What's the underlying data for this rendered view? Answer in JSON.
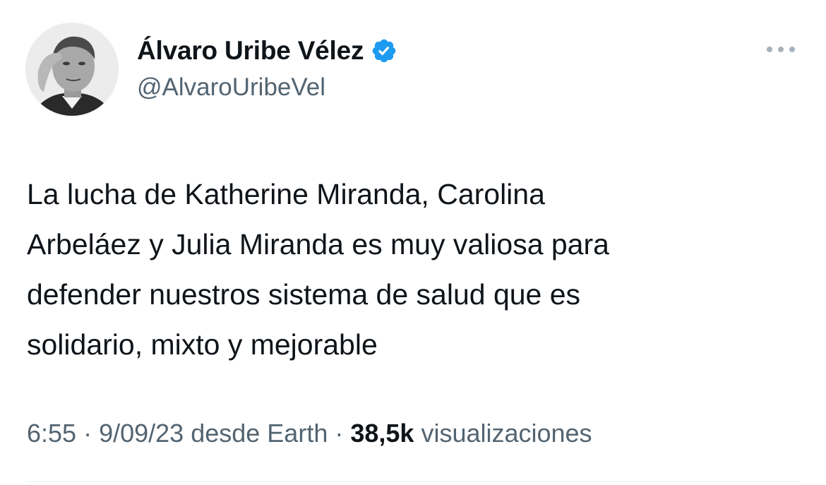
{
  "author": {
    "display_name": "Álvaro Uribe Vélez",
    "handle": "@AlvaroUribeVel",
    "verified_icon": "verified-badge-icon",
    "verified_color": "#1d9bf0"
  },
  "tweet": {
    "text_lines": [
      "La lucha de Katherine Miranda, Carolina",
      "Arbeláez y Julia Miranda es muy valiosa para",
      "defender nuestros sistema de salud que es",
      "solidario, mixto y mejorable"
    ]
  },
  "meta": {
    "time": "6:55",
    "sep1": " · ",
    "date": "9/09/23",
    "source": " desde Earth",
    "sep2": " · ",
    "views": "38,5k",
    "views_label": " visualizaciones"
  },
  "colors": {
    "text_primary": "#0f1419",
    "text_secondary": "#536471",
    "more_dots": "#a7b1ba"
  }
}
